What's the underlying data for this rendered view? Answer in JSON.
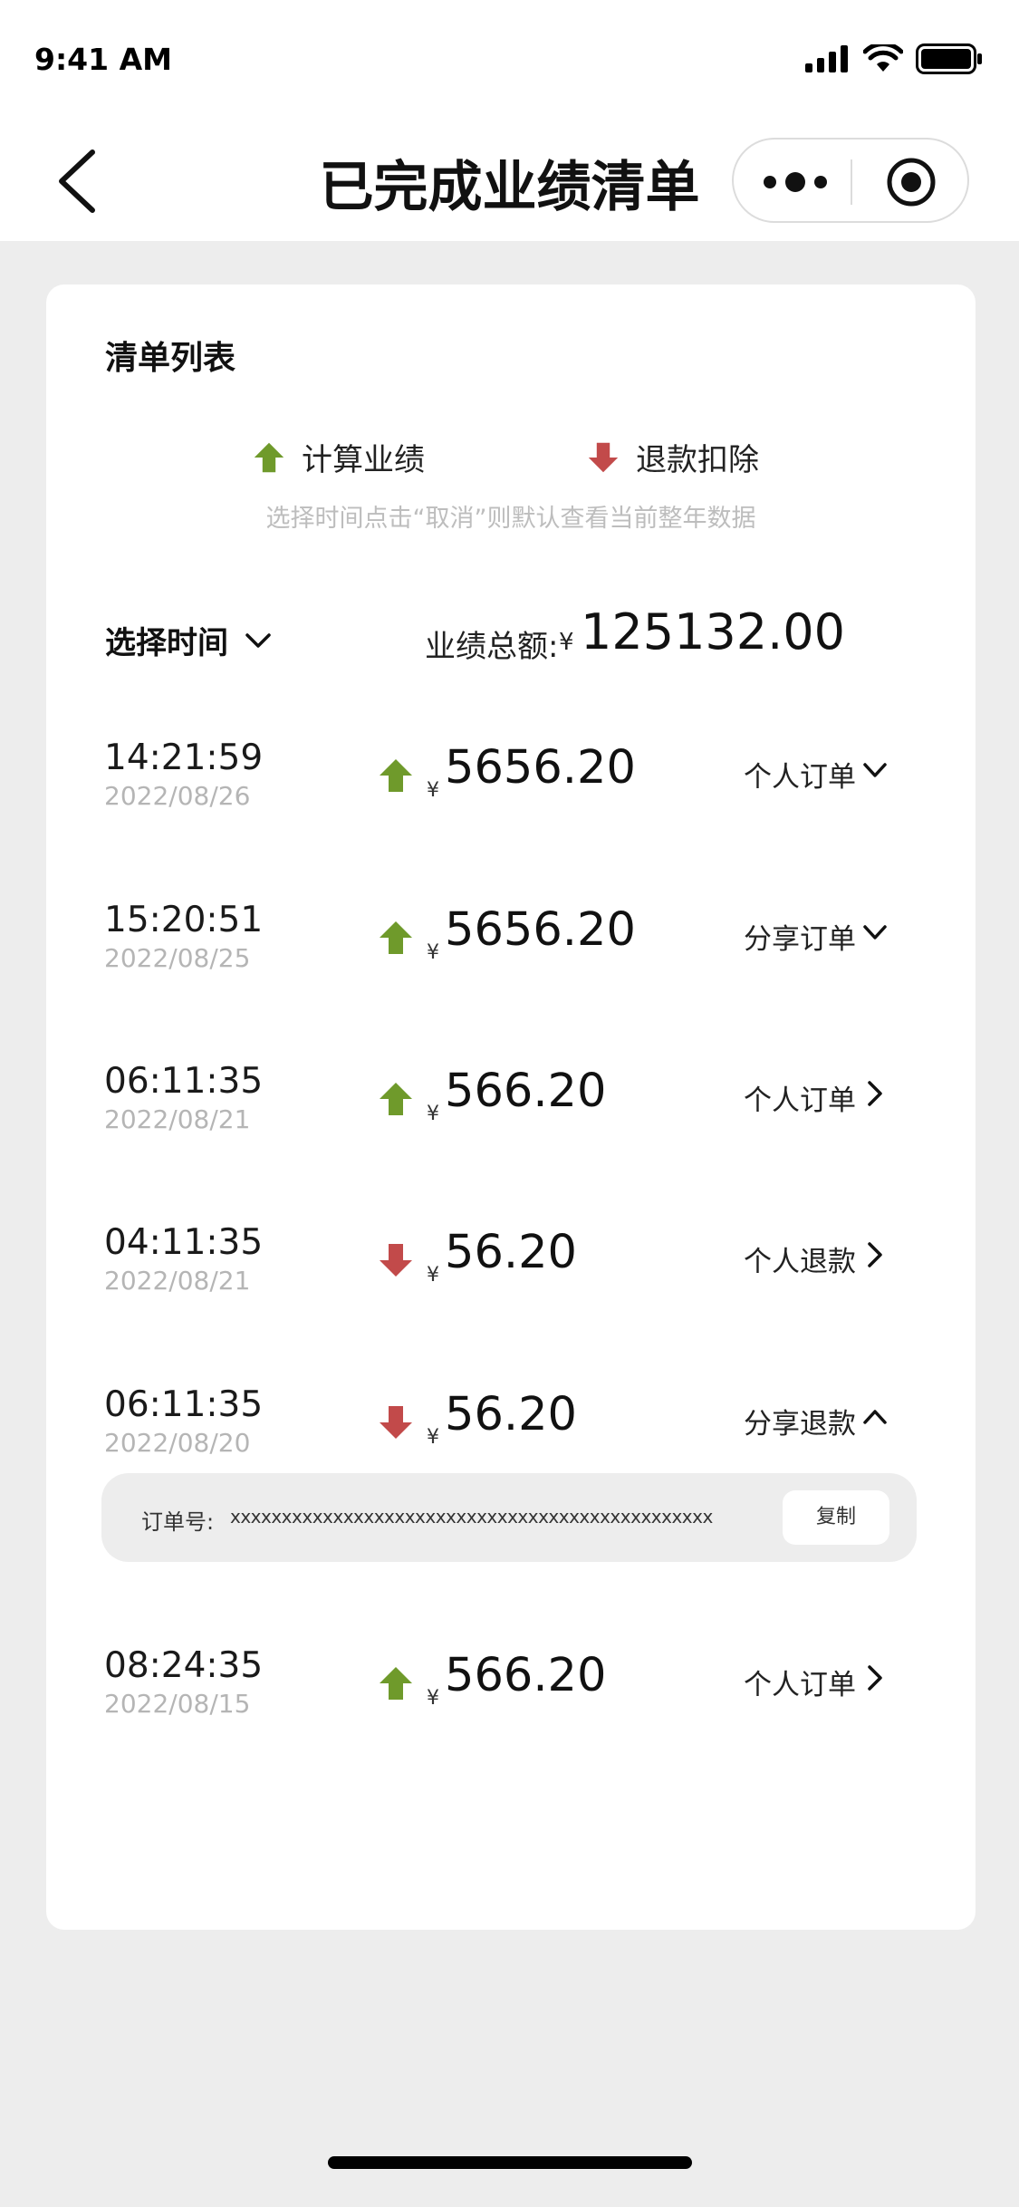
{
  "status_bar": {
    "time": "9:41 AM"
  },
  "navbar": {
    "title": "已完成业绩清单"
  },
  "card": {
    "title": "清单列表",
    "legend": {
      "up_label": "计算业绩",
      "down_label": "退款扣除"
    },
    "hint": "选择时间点击“取消”则默认查看当前整年数据",
    "select_time": "选择时间",
    "total_label": "业绩总额:",
    "currency": "¥",
    "total_value": "125132.00"
  },
  "rows": [
    {
      "time": "14:21:59",
      "date": "2022/08/26",
      "direction": "up",
      "amount": "5656.20",
      "kind": "个人订单",
      "chevron": "down"
    },
    {
      "time": "15:20:51",
      "date": "2022/08/25",
      "direction": "up",
      "amount": "5656.20",
      "kind": "分享订单",
      "chevron": "down"
    },
    {
      "time": "06:11:35",
      "date": "2022/08/21",
      "direction": "up",
      "amount": "566.20",
      "kind": "个人订单",
      "chevron": "right"
    },
    {
      "time": "04:11:35",
      "date": "2022/08/21",
      "direction": "down",
      "amount": "56.20",
      "kind": "个人退款",
      "chevron": "right"
    },
    {
      "time": "06:11:35",
      "date": "2022/08/20",
      "direction": "down",
      "amount": "56.20",
      "kind": "分享退款",
      "chevron": "up"
    },
    {
      "time": "08:24:35",
      "date": "2022/08/15",
      "direction": "up",
      "amount": "566.20",
      "kind": "个人订单",
      "chevron": "right"
    }
  ],
  "order_panel": {
    "label": "订单号:",
    "order_number": "xxxxxxxxxxxxxxxxxxxxxxxxxxxxxxxxxxxxxxxxxxxxxxx",
    "copy_label": "复制"
  },
  "colors": {
    "up": "#6f9a2b",
    "down": "#c24a4a",
    "background": "#ededed"
  }
}
